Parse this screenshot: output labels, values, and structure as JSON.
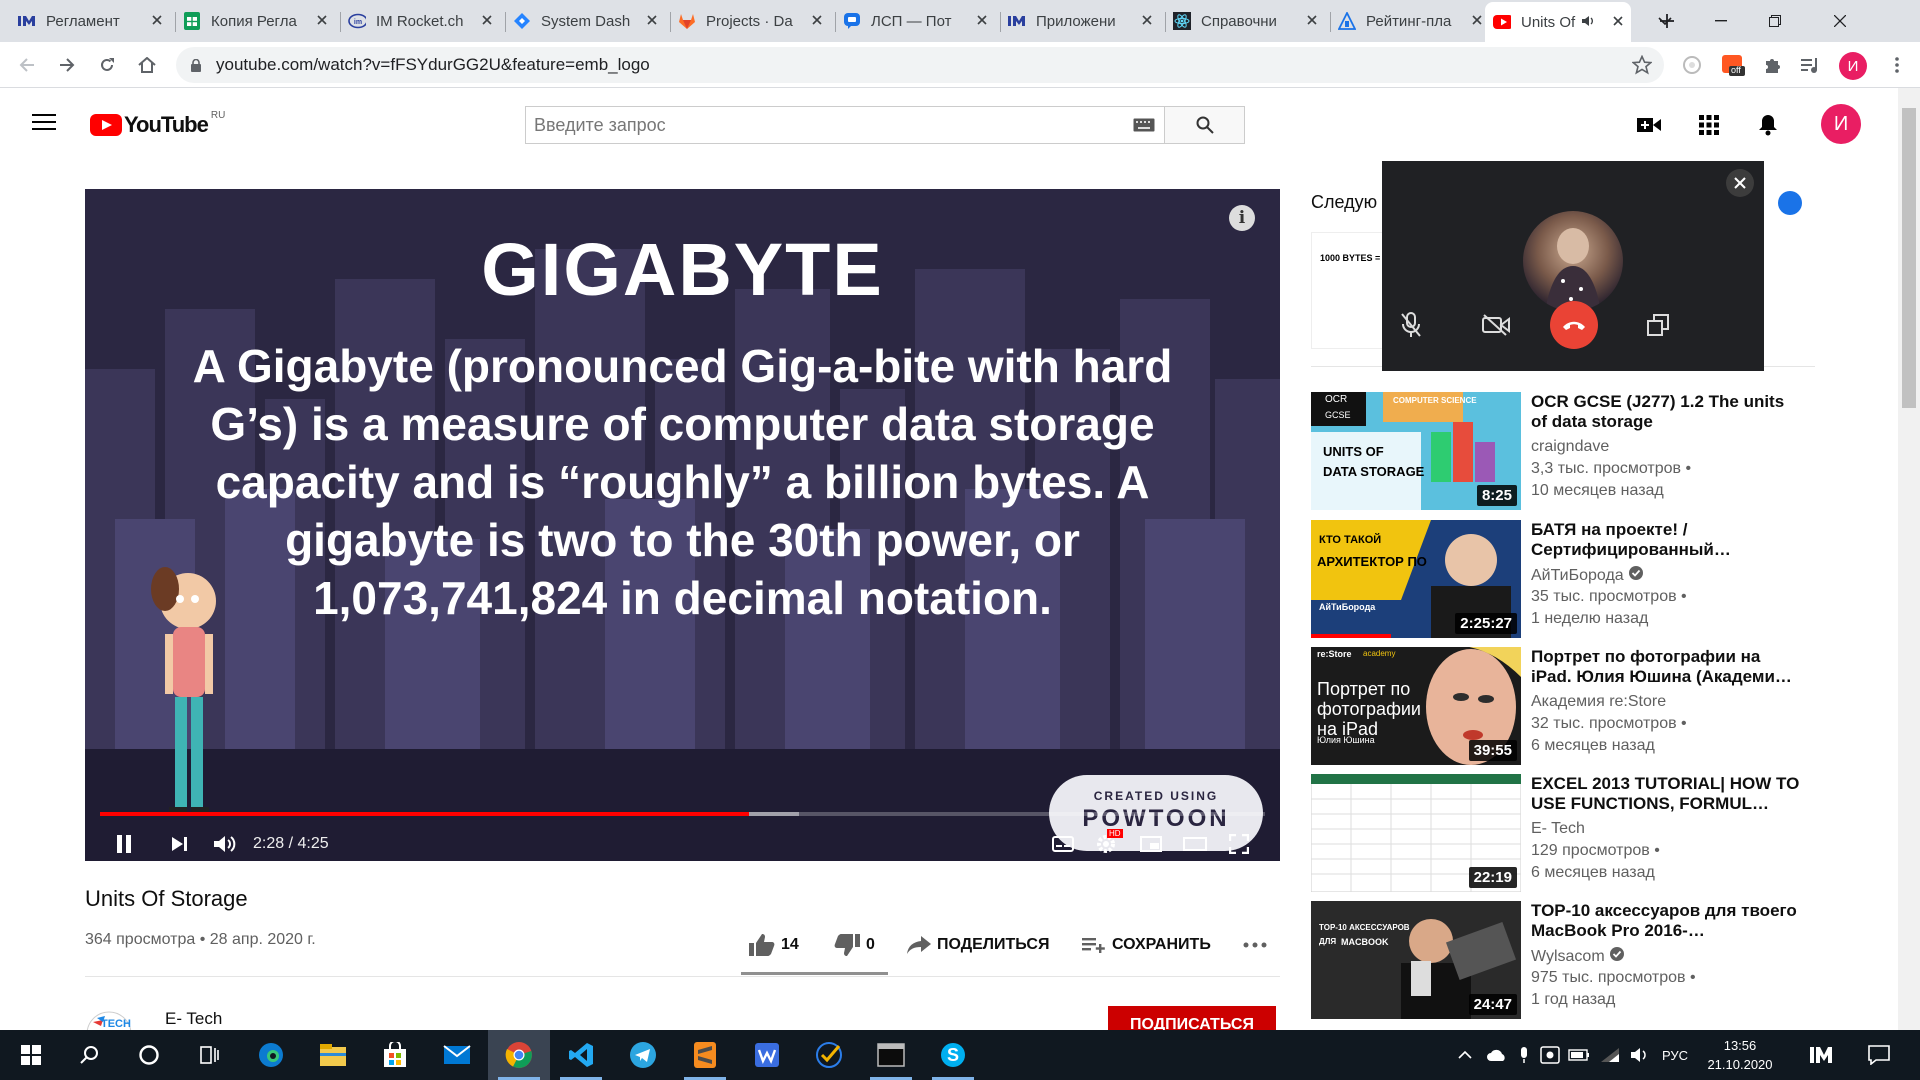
{
  "browser": {
    "tabs": [
      {
        "label": "Регламент",
        "icon": "im-icon",
        "color": "#2a3f9e"
      },
      {
        "label": "Копия Регла",
        "icon": "sheets-icon",
        "color": "#0f9d58"
      },
      {
        "label": "IM Rocket.ch",
        "icon": "rocketchat-icon",
        "color": "#2a3f9e"
      },
      {
        "label": "System Dash",
        "icon": "jira-icon",
        "color": "#2684ff"
      },
      {
        "label": "Projects · Da",
        "icon": "gitlab-icon",
        "color": "#fc6d26"
      },
      {
        "label": "ЛСП — Пот",
        "icon": "chat-icon",
        "color": "#1a73e8"
      },
      {
        "label": "Приложени",
        "icon": "im-icon",
        "color": "#2a3f9e"
      },
      {
        "label": "Справочни",
        "icon": "react-icon",
        "color": "#61dafb"
      },
      {
        "label": "Рейтинг-пла",
        "icon": "rating-icon",
        "color": "#1a73e8"
      },
      {
        "label": "Units Of",
        "icon": "youtube-icon",
        "color": "#ff0000"
      }
    ],
    "url": "youtube.com/watch?v=fFSYdurGG2U&feature=emb_logo",
    "profile_initial": "И",
    "ext_badge": "off"
  },
  "youtube": {
    "logo_text": "YouTube",
    "logo_region": "RU",
    "search_placeholder": "Введите запрос",
    "avatar_initial": "И"
  },
  "player": {
    "slide_title": "GIGABYTE",
    "slide_lines": [
      "A Gigabyte (pronounced Gig-a-bite with hard",
      "G’s) is a measure of computer data storage",
      "capacity and is “roughly” a billion bytes. A",
      "gigabyte is two to the 30th power, or",
      "1,073,741,824 in decimal notation."
    ],
    "watermark_top": "CREATED USING",
    "watermark_brand": "POWTOON",
    "time_display": "2:28 / 4:25",
    "played_fraction": 0.557,
    "buffered_fraction": 0.6,
    "info_symbol": "i",
    "hd_badge": "HD"
  },
  "video": {
    "title": "Units Of Storage",
    "meta": "364 просмотра • 28 апр. 2020 г.",
    "likes": "14",
    "dislikes": "0",
    "share_label": "ПОДЕЛИТЬСЯ",
    "save_label": "СОХРАНИТЬ",
    "channel": "E- Tech",
    "channel_logo_text": "TECH",
    "subscribe_label": "ПОДПИСАТЬСЯ"
  },
  "sidebar": {
    "next_label": "Следую",
    "next_thumb_text": "1000 BYTES =",
    "recommendations": [
      {
        "title": "OCR GCSE (J277) 1.2 The units of data storage",
        "channel": "craigndave",
        "verified": false,
        "views": "3,3 тыс. просмотров •",
        "age": "10 месяцев назад",
        "duration": "8:25",
        "thumb_lines": [
          "OCR",
          "GCSE",
          "UNITS OF",
          "DATA STORAGE",
          "COMPUTER SCIENCE"
        ]
      },
      {
        "title": "БАТЯ на проекте! / Сертифицированный…",
        "channel": "АйТиБорода",
        "verified": true,
        "views": "35 тыс. просмотров •",
        "age": "1 неделю назад",
        "duration": "2:25:27",
        "thumb_lines": [
          "КТО ТАКОЙ",
          "АРХИТЕКТОР ПО",
          "АйТиБорода"
        ]
      },
      {
        "title": "Портрет по фотографии на iPad. Юлия Юшина (Академи…",
        "channel": "Академия re:Store",
        "verified": false,
        "views": "32 тыс. просмотров •",
        "age": "6 месяцев назад",
        "duration": "39:55",
        "thumb_lines": [
          "re:Store",
          "academy",
          "Портрет по",
          "фотографии",
          "на iPad",
          "Юлия Юшина"
        ]
      },
      {
        "title": "EXCEL 2013 TUTORIAL| HOW TO USE FUNCTIONS, FORMUL…",
        "channel": "E- Tech",
        "verified": false,
        "views": "129 просмотров •",
        "age": "6 месяцев назад",
        "duration": "22:19",
        "thumb_lines": []
      },
      {
        "title": "TOP-10 аксессуаров для твоего MacBook Pro 2016-…",
        "channel": "Wylsacom",
        "verified": true,
        "views": "975 тыс. просмотров •",
        "age": "1 год назад",
        "duration": "24:47",
        "thumb_lines": [
          "TOP-10 АКСЕССУАРОВ",
          "ДЛЯ",
          "MACBOOK"
        ]
      }
    ]
  },
  "taskbar": {
    "lang": "РУС",
    "time": "13:56",
    "date": "21.10.2020"
  },
  "colors": {
    "yt_red": "#ff0000",
    "subscribe_red": "#cc0000",
    "player_bg": "#2a2540",
    "end_call": "#ea4335"
  }
}
